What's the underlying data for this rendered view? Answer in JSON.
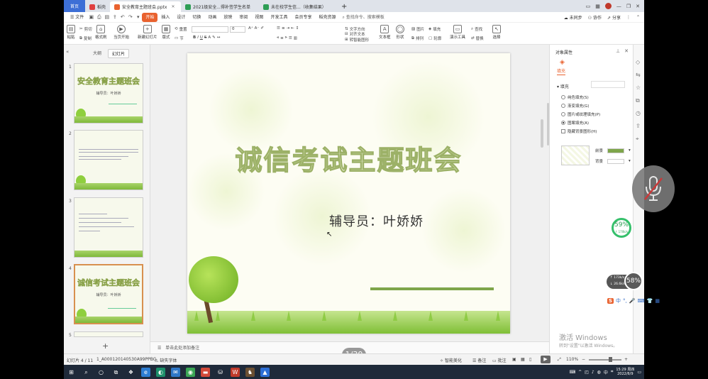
{
  "tabs": {
    "home": "首页",
    "items": [
      {
        "label": "稻壳",
        "color": "#e04040"
      },
      {
        "label": "安全教育主题班会.pptx",
        "color": "#e9622f",
        "active": true
      },
      {
        "label": "2021级安全...得补签学生名单",
        "color": "#2e9e55"
      },
      {
        "label": "未在校学生信...（收集结果）",
        "color": "#2e9e55"
      }
    ],
    "new_tab": "+"
  },
  "window_controls": {
    "min": "—",
    "max": "❐",
    "close": "✕"
  },
  "menu": {
    "file": "文件",
    "items": [
      "开始",
      "插入",
      "设计",
      "切换",
      "动画",
      "放映",
      "审阅",
      "视图",
      "开发工具",
      "会员专享",
      "稻壳资源"
    ],
    "active": "开始",
    "search": "查找命令、搜索模板",
    "unsynced": "未同步",
    "collab": "协作",
    "share": "分享"
  },
  "ribbon": {
    "paste": "粘贴",
    "cut": "剪切",
    "copy": "复制",
    "format_painter": "格式刷",
    "from_current": "当页开始",
    "new_slide": "新建幻灯片",
    "layout": "版式",
    "section": "节",
    "reset": "重置",
    "font_size": "0",
    "text_direction": "文字方向",
    "align_text": "对齐文本",
    "convert_smartart": "转智能图形",
    "textbox": "文本框",
    "shape": "形状",
    "arrange": "排列",
    "picture": "图片",
    "fill": "填充",
    "outline": "轮廓",
    "presentation_tools": "演示工具",
    "find": "查找",
    "replace": "替换",
    "select": "选择"
  },
  "leftpane": {
    "tab_outline": "大纲",
    "tab_slides": "幻灯片",
    "thumbs": [
      {
        "num": "1",
        "title": "安全教育主题班会",
        "sub": "辅导员：叶娇娇"
      },
      {
        "num": "2",
        "title": "",
        "sub": ""
      },
      {
        "num": "3",
        "title": "",
        "sub": ""
      },
      {
        "num": "4",
        "title": "诚信考试主题班会",
        "sub": "辅导员：叶娇娇",
        "selected": true
      },
      {
        "num": "5",
        "title": "",
        "sub": ""
      }
    ],
    "add": "+"
  },
  "slide": {
    "title": "诚信考试主题班会",
    "subtitle": "辅导员：叶娇娇"
  },
  "notes_placeholder": "单击此处添加备注",
  "page_badge": "1/30",
  "object_pane": {
    "title": "对象属性",
    "fill_tab": "填充",
    "fill_section": "填充",
    "fill_dropdown": "",
    "options": [
      {
        "label": "纯色填充(S)",
        "type": "radio",
        "checked": false
      },
      {
        "label": "渐变填充(G)",
        "type": "radio",
        "checked": false
      },
      {
        "label": "图片或纹理填充(P)",
        "type": "radio",
        "checked": false
      },
      {
        "label": "图案填充(A)",
        "type": "radio",
        "checked": true
      },
      {
        "label": "隐藏背景图形(H)",
        "type": "checkbox",
        "checked": false
      }
    ],
    "foreground_label": "前景",
    "foreground_color": "#7ea54a",
    "background_label": "背景",
    "background_color": "#ffffff"
  },
  "watermark": {
    "line1": "激活 Windows",
    "line2": "转到\"设置\"以激活 Windows。"
  },
  "statusbar": {
    "slide_info": "幻灯片 4 / 11",
    "doc_id": "1_A000120140530A99PPBG",
    "missing_font": "缺失字体",
    "smart_beautify": "智能美化",
    "notes": "备注",
    "comments": "批注",
    "zoom": "110%"
  },
  "overlay": {
    "percent_59": "59%",
    "speed_59": "↑ 170k/s",
    "net_up": "↑ 173k/s",
    "net_down": "↓ 26.6k/s",
    "percent_58": "58%",
    "ime": "中"
  },
  "taskbar": {
    "time": "15:29 周四",
    "date": "2022/6/9"
  }
}
